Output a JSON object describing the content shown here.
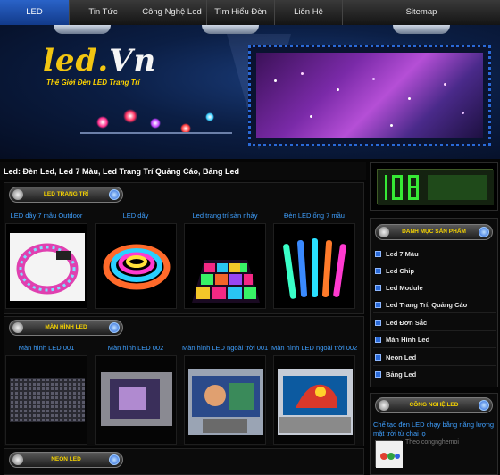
{
  "nav": {
    "items": [
      {
        "label": "LED",
        "active": true
      },
      {
        "label": "Tin Tức",
        "active": false
      },
      {
        "label": "Công Nghệ Led",
        "active": false
      },
      {
        "label": "Tìm Hiểu Đèn Led",
        "active": false
      },
      {
        "label": "Liên Hệ",
        "active": false
      },
      {
        "label": "Sitemap",
        "active": false
      }
    ]
  },
  "banner": {
    "logo_main": "led.",
    "logo_accent": "Vn",
    "slogan": "Thế Giới Đèn LED Trang Trí"
  },
  "headline": "Led: Đèn Led, Led 7 Màu, Led Trang Trí Quảng Cáo, Bảng Led",
  "sections": [
    {
      "title": "LED TRANG TRÍ",
      "products": [
        {
          "title": "LED dây 7 mẫu Outdoor"
        },
        {
          "title": "LED dây"
        },
        {
          "title": "Led trang trí sàn nhảy"
        },
        {
          "title": "Đèn LED ống 7 mầu"
        }
      ]
    },
    {
      "title": "MÀN HÌNH LED",
      "products": [
        {
          "title": "Màn hình LED 001"
        },
        {
          "title": "Màn hình LED 002"
        },
        {
          "title": "Màn hình LED ngoài trời 001"
        },
        {
          "title": "Màn hình LED ngoài trời 002"
        }
      ]
    },
    {
      "title": "NEON LED",
      "products": []
    }
  ],
  "sidebar": {
    "categories_title": "DANH MỤC SẢN PHẨM",
    "categories": [
      "Led 7 Màu",
      "Led Chip",
      "Led Module",
      "Led Trang Trí, Quảng Cáo",
      "Led Đơn Sắc",
      "Màn Hình Led",
      "Neon Led",
      "Bảng Led"
    ],
    "tech_title": "CÔNG NGHỆ LED",
    "news_link": "Chế tạo đèn LED chạy bằng năng lượng mặt trời từ chai lọ",
    "news_by": "Theo congnghemoi"
  },
  "colors": {
    "nav_active": "#2a63c8",
    "link": "#3fa0ff",
    "heading_yellow": "#f5d300",
    "logo_yellow": "#f2c511"
  }
}
